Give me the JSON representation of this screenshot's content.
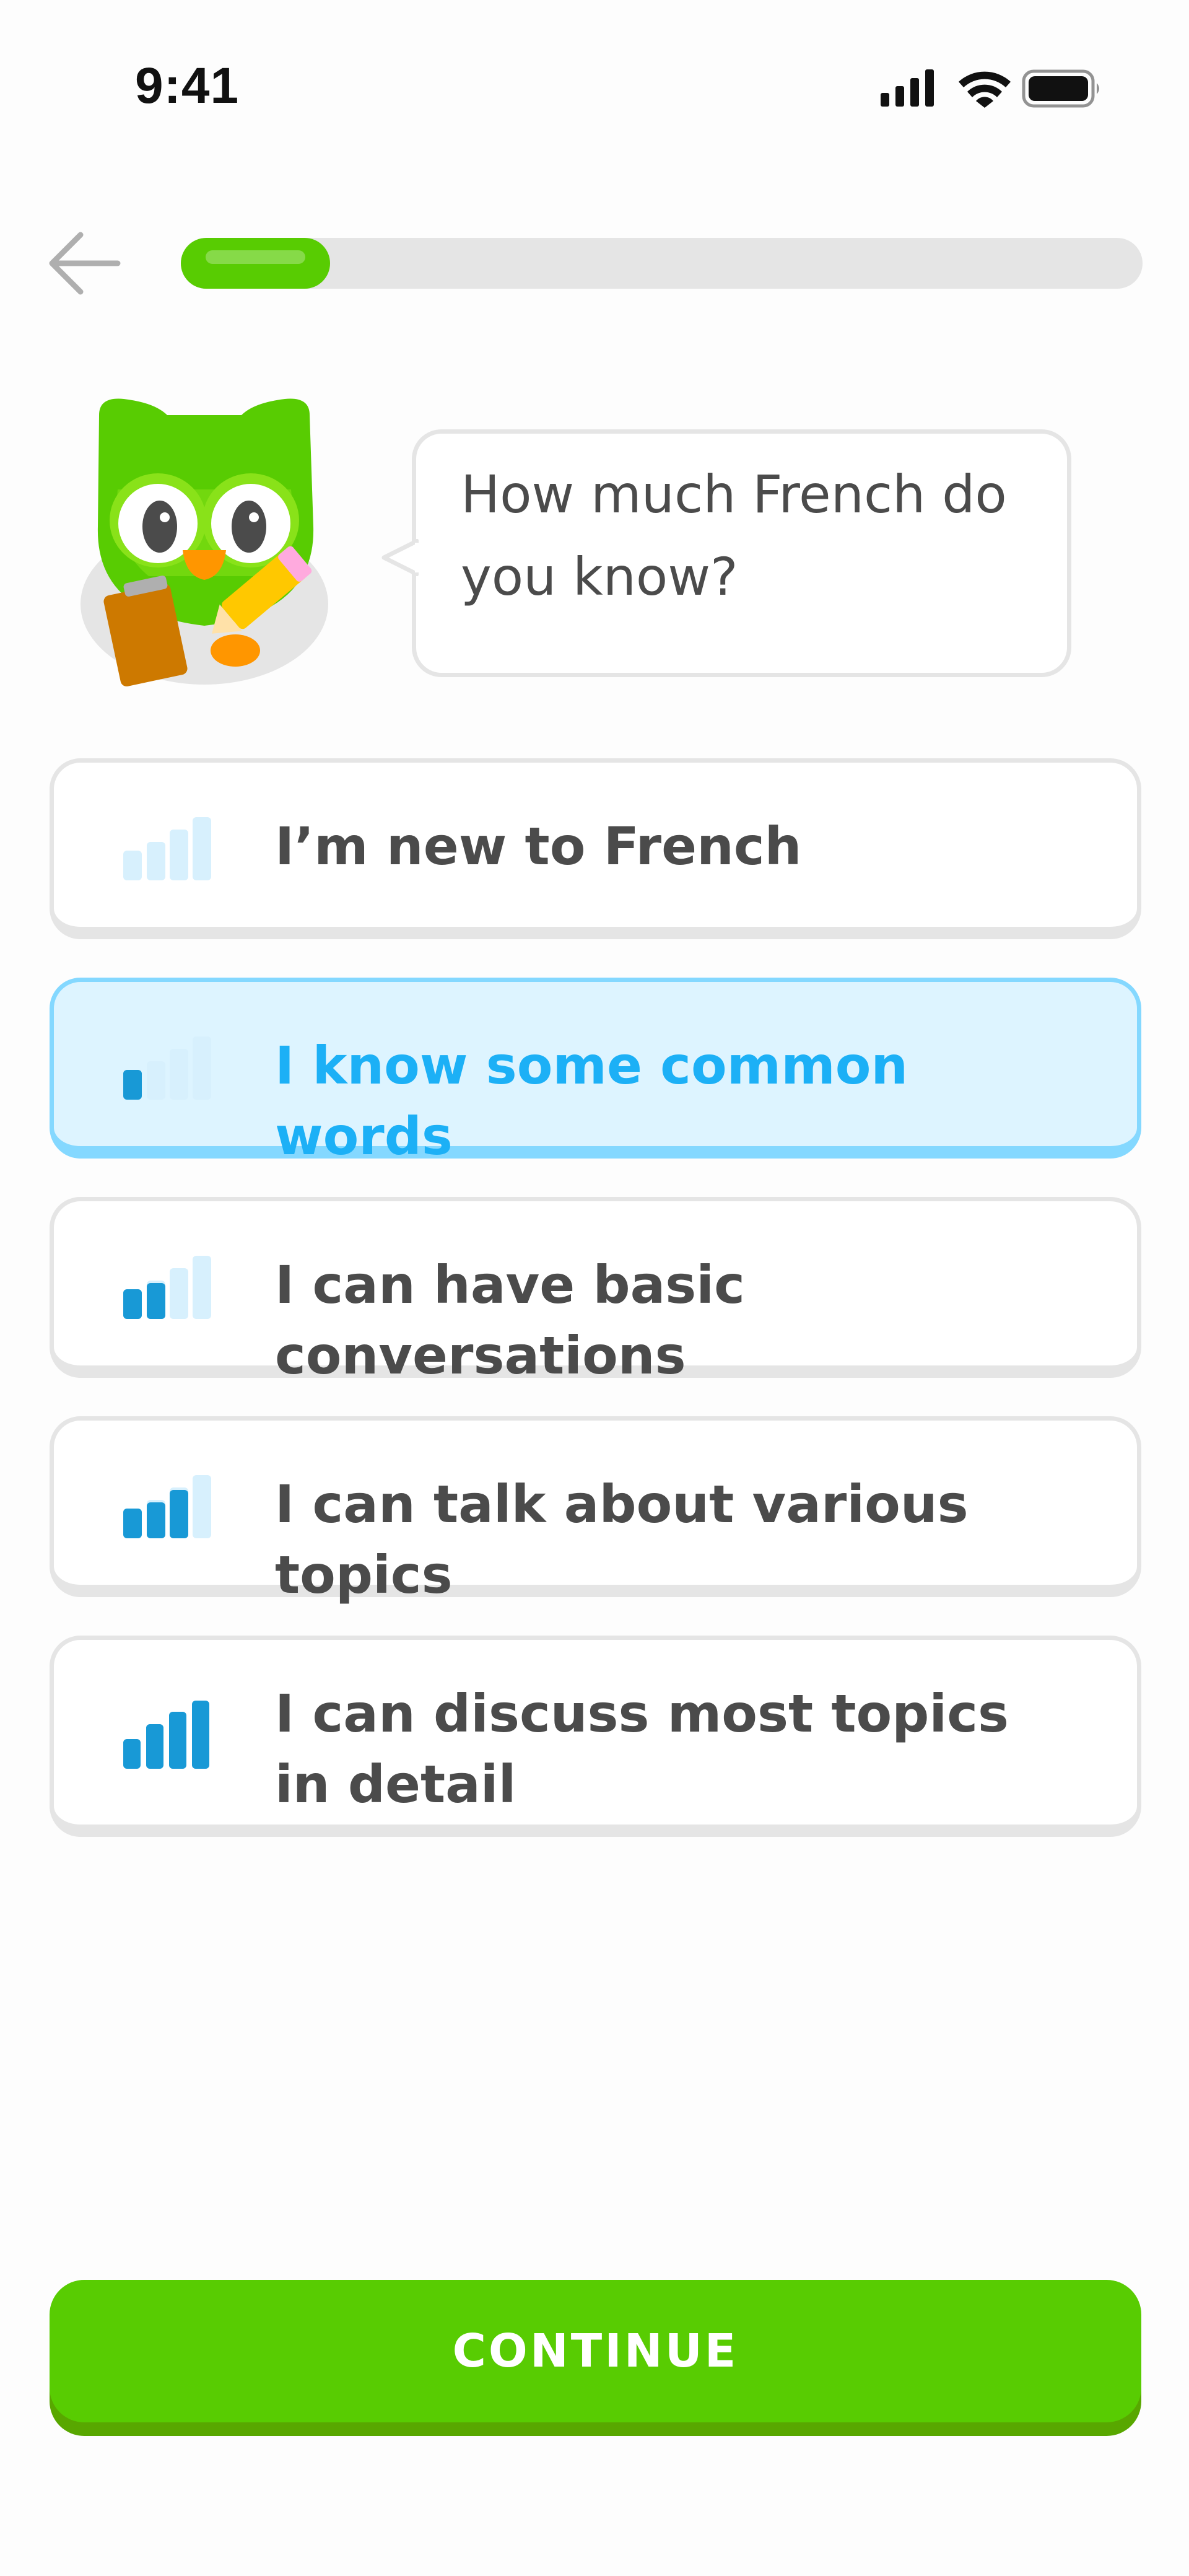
{
  "status_bar": {
    "time": "9:41",
    "icons": [
      "cellular-signal-icon",
      "wifi-icon",
      "battery-icon"
    ]
  },
  "header": {
    "back_icon": "arrow-left-icon",
    "progress": 0.155
  },
  "prompt": {
    "question": "How much French do you know?"
  },
  "options": [
    {
      "label": "I’m new to French",
      "level": 0,
      "selected": false
    },
    {
      "label": "I know some common words",
      "level": 1,
      "selected": true
    },
    {
      "label": "I can have basic conversations",
      "level": 2,
      "selected": false
    },
    {
      "label": "I can talk about various topics",
      "level": 3,
      "selected": false
    },
    {
      "label": "I can discuss most topics in detail",
      "level": 4,
      "selected": false
    }
  ],
  "footer": {
    "continue_label": "CONTINUE"
  },
  "colors": {
    "brand_green": "#58CC02",
    "selected_blue": "#1CB0F6",
    "selected_bg": "#DDF4FF",
    "border_gray": "#E5E5E5",
    "text_gray": "#4B4B4B"
  }
}
